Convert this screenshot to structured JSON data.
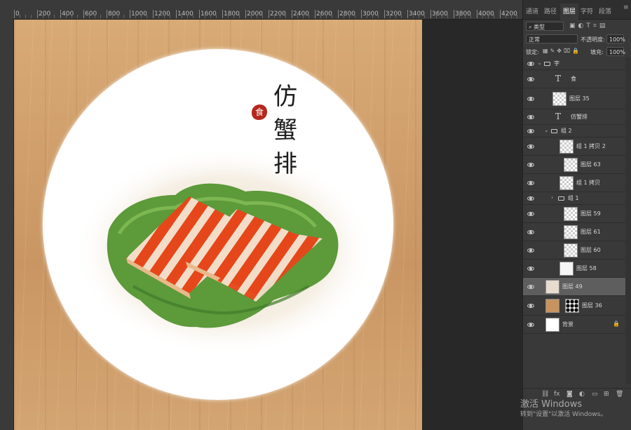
{
  "ruler": {
    "labels": [
      "0",
      "200",
      "400",
      "600",
      "800",
      "1000",
      "1200",
      "1400",
      "1600",
      "1800",
      "2000",
      "2200",
      "2400",
      "2600",
      "2800",
      "3000",
      "3200",
      "3400",
      "3600",
      "3800",
      "4000",
      "4200"
    ]
  },
  "canvas": {
    "title_chars": [
      "仿",
      "蟹",
      "排"
    ],
    "seal_text": "食"
  },
  "panel": {
    "tabs": [
      "通道",
      "路径",
      "图层",
      "字符",
      "段落"
    ],
    "active_tab": "图层",
    "filter_label": "类型",
    "blend_mode": "正常",
    "opacity_label": "不透明度:",
    "opacity_value": "100%",
    "lock_label": "锁定:",
    "fill_label": "填充:",
    "fill_value": "100%",
    "layers": [
      {
        "name": "字",
        "kind": "group"
      },
      {
        "name": "食",
        "kind": "text"
      },
      {
        "name": "图层 35",
        "kind": "pixel"
      },
      {
        "name": "仿蟹排",
        "kind": "text"
      },
      {
        "name": "组 2",
        "kind": "group"
      },
      {
        "name": "组 1 拷贝 2",
        "kind": "pixel"
      },
      {
        "name": "图层 63",
        "kind": "pixel"
      },
      {
        "name": "组 1 拷贝",
        "kind": "pixel"
      },
      {
        "name": "组 1",
        "kind": "group"
      },
      {
        "name": "图层 59",
        "kind": "pixel"
      },
      {
        "name": "图层 61",
        "kind": "pixel"
      },
      {
        "name": "图层 60",
        "kind": "pixel"
      },
      {
        "name": "图层 58",
        "kind": "pixel"
      },
      {
        "name": "图层 49",
        "kind": "pixel",
        "selected": true
      },
      {
        "name": "图层 36",
        "kind": "pixel"
      },
      {
        "name": "背景",
        "kind": "background"
      }
    ],
    "bottom_icons": [
      "link-icon",
      "fx-icon",
      "mask-icon",
      "adjustment-icon",
      "folder-icon",
      "new-layer-icon",
      "trash-icon"
    ],
    "bottom_fx_label": "fx"
  },
  "watermark": {
    "line1": "激活 Windows",
    "line2": "转到\"设置\"以激活 Windows。"
  }
}
